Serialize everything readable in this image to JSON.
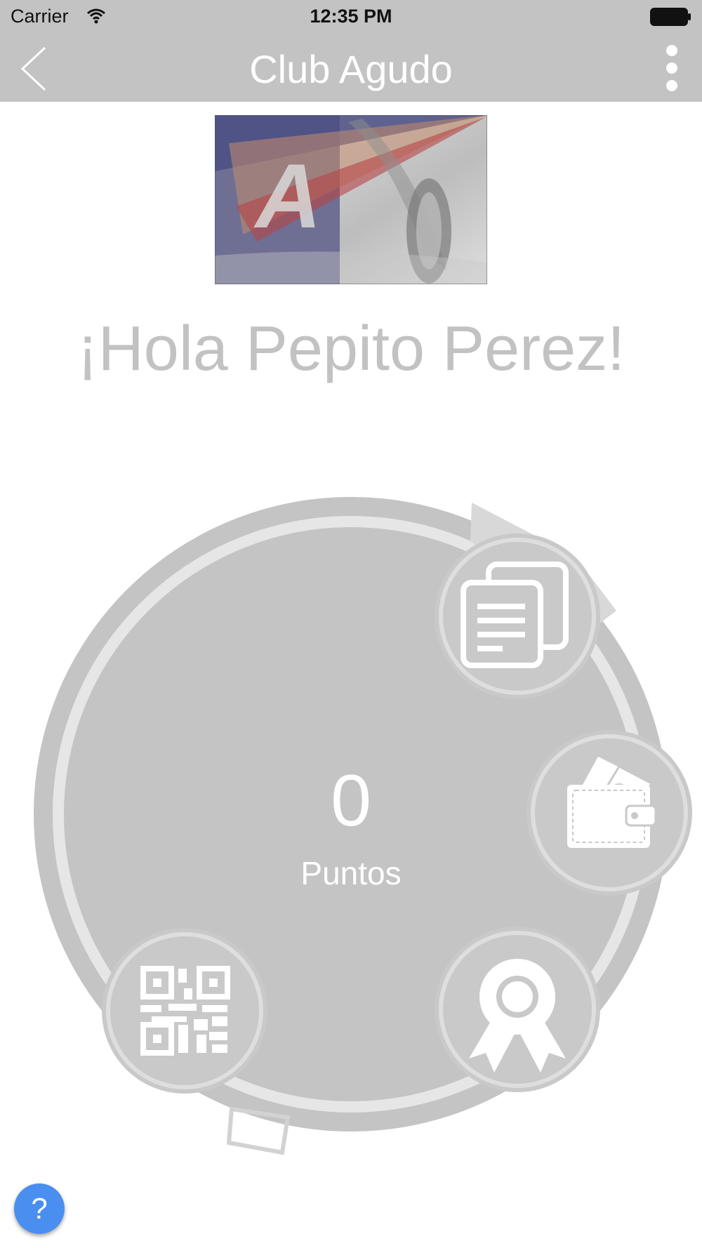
{
  "status_bar": {
    "carrier": "Carrier",
    "time": "12:35 PM",
    "wifi_icon": "wifi-icon",
    "battery_icon": "battery-icon"
  },
  "nav": {
    "title": "Club Agudo",
    "back_icon": "chevron-left-icon",
    "more_icon": "more-vertical-icon",
    "bar_color": "#c3c3c3"
  },
  "banner": {
    "logo_letter": "A"
  },
  "greeting": "¡Hola Pepito Perez!",
  "points": {
    "value": "0",
    "label": "Puntos"
  },
  "actions": [
    {
      "icon": "documents-icon"
    },
    {
      "icon": "wallet-icon"
    },
    {
      "icon": "award-icon"
    },
    {
      "icon": "qr-code-icon"
    }
  ],
  "help": {
    "label": "?",
    "color": "#4a8ff0"
  },
  "colors": {
    "dial_fill": "#c4c4c4",
    "dial_ring": "#e6e6e6",
    "accent": "#4a8ff0"
  }
}
